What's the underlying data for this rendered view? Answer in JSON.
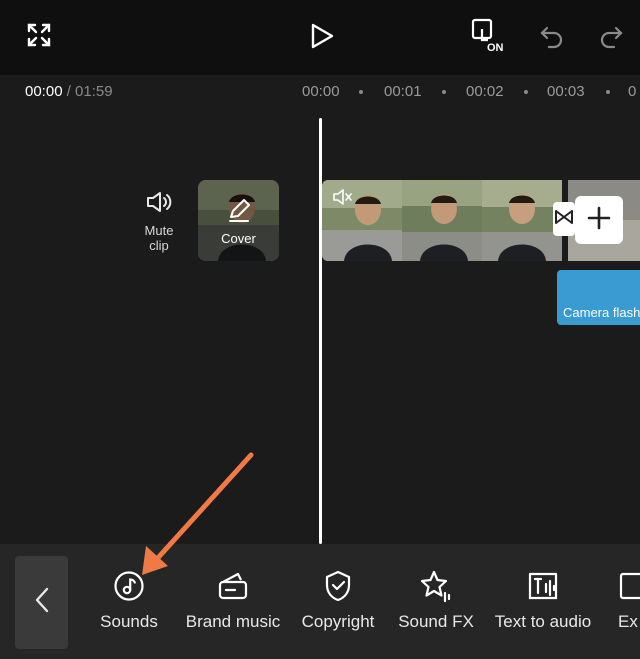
{
  "time": {
    "current": "00:00",
    "total": "/ 01:59"
  },
  "ruler": {
    "ticks": [
      "00:00",
      "00:01",
      "00:02",
      "00:03",
      "0"
    ]
  },
  "track": {
    "mute_label_line1": "Mute",
    "mute_label_line2": "clip",
    "cover_label": "Cover"
  },
  "clips": {
    "text_clip_label": "Camera flash"
  },
  "toolbar": {
    "items": [
      {
        "label": "Sounds",
        "icon": "music-note-icon"
      },
      {
        "label": "Brand music",
        "icon": "brand-music-icon"
      },
      {
        "label": "Copyright",
        "icon": "shield-check-icon"
      },
      {
        "label": "Sound FX",
        "icon": "star-sparkle-icon"
      },
      {
        "label": "Text to audio",
        "icon": "text-to-audio-icon"
      },
      {
        "label": "Ex",
        "icon": "extract-icon"
      }
    ]
  },
  "annotation": {
    "arrow_color": "#f07a45"
  },
  "colors": {
    "text_clip": "#3a9ad2",
    "background": "#1b1b1b"
  }
}
